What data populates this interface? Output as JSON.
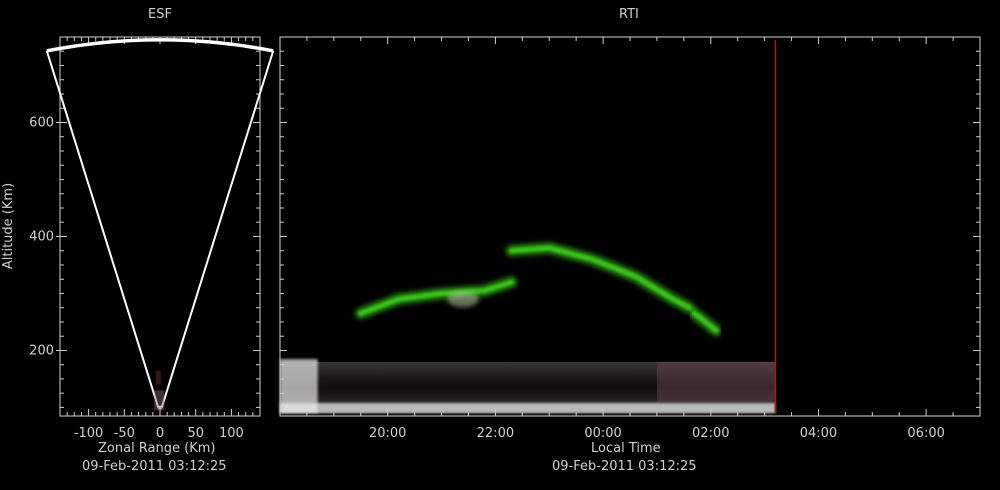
{
  "chart_data": [
    {
      "type": "heatmap",
      "panel": "esf",
      "title": "ESF",
      "xlabel": "Zonal Range (Km)",
      "ylabel": "Altitude (Km)",
      "timestamp": "09-Feb-2011 03:12:25",
      "xlim": [
        -140,
        140
      ],
      "ylim": [
        85,
        750
      ],
      "xticks": [
        -100,
        -50,
        0,
        50,
        100
      ],
      "xtick_labels": [
        "-100",
        "-50",
        "0",
        "50",
        "100"
      ],
      "yticks": [
        200,
        400,
        600
      ],
      "ytick_labels": [
        "200",
        "400",
        "600"
      ],
      "beam_cone": {
        "apex_altitude": 90,
        "half_angle_deg": 14,
        "max_altitude": 745
      }
    },
    {
      "type": "heatmap",
      "panel": "rti",
      "title": "RTI",
      "xlabel": "Local Time",
      "timestamp": "09-Feb-2011 03:12:25",
      "xlim": [
        18.0,
        31.0
      ],
      "ylim": [
        85,
        750
      ],
      "xticks": [
        20,
        22,
        24,
        26,
        28,
        30
      ],
      "xtick_labels": [
        "20:00",
        "22:00",
        "00:00",
        "02:00",
        "04:00",
        "06:00"
      ],
      "yticks": [
        200,
        400,
        600
      ],
      "data_end_time": 27.2,
      "current_time_marker": 27.2,
      "marker_color": "#b01818",
      "echo_color": "#3cd11e",
      "echo_traces": [
        {
          "name": "",
          "points": [
            [
              19.5,
              265
            ],
            [
              20.2,
              290
            ],
            [
              21.0,
              300
            ],
            [
              21.8,
              305
            ],
            [
              22.3,
              320
            ]
          ]
        },
        {
          "name": "",
          "points": [
            [
              22.3,
              375
            ],
            [
              23.0,
              380
            ],
            [
              23.8,
              360
            ],
            [
              24.6,
              330
            ],
            [
              25.3,
              290
            ],
            [
              25.6,
              275
            ]
          ]
        },
        {
          "name": "",
          "points": [
            [
              25.7,
              265
            ],
            [
              26.1,
              235
            ]
          ]
        }
      ]
    }
  ]
}
